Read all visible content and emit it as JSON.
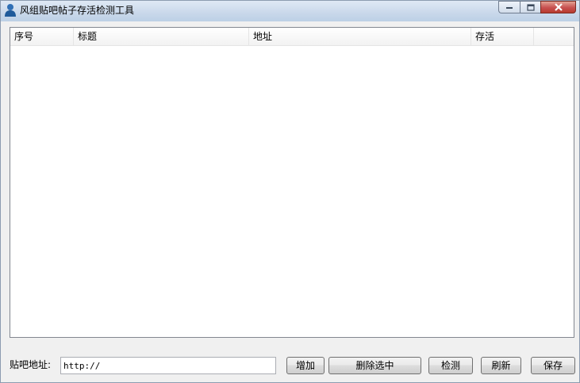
{
  "window": {
    "title": "风组贴吧帖子存活检测工具",
    "icon": "user-icon"
  },
  "list": {
    "columns": [
      "序号",
      "标题",
      "地址",
      "存活"
    ],
    "rows": []
  },
  "form": {
    "url_label": "贴吧地址:",
    "url_value": "http://"
  },
  "buttons": {
    "add": "增加",
    "delete_selected": "删除选中",
    "check": "检测",
    "refresh": "刷新",
    "save": "保存"
  }
}
